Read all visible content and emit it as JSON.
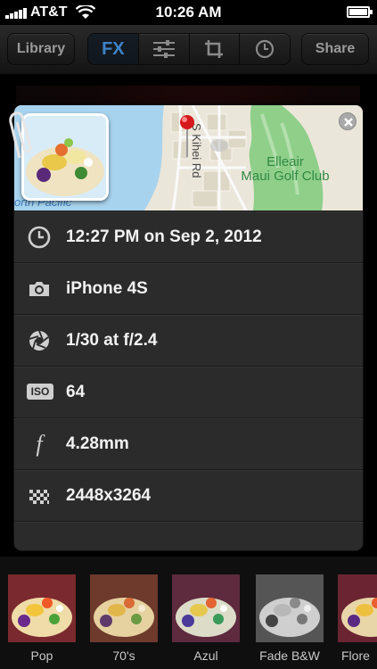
{
  "status_bar": {
    "carrier": "AT&T",
    "time": "10:26 AM"
  },
  "toolbar": {
    "library_label": "Library",
    "fx_label": "FX",
    "share_label": "Share",
    "segments": [
      "fx",
      "adjust-sliders-icon",
      "crop-icon",
      "history-clock-icon"
    ]
  },
  "info": {
    "map": {
      "street_label": "S Kihei Rd",
      "place_label_line1": "Elleair",
      "place_label_line2": "Maui Golf Club",
      "water_label": "orth Pacific"
    },
    "rows": [
      {
        "icon": "clock-icon",
        "value": "12:27 PM on Sep 2, 2012"
      },
      {
        "icon": "camera-icon",
        "value": "iPhone 4S"
      },
      {
        "icon": "aperture-icon",
        "value": "1/30 at f/2.4"
      },
      {
        "icon": "iso-icon",
        "icon_text": "ISO",
        "value": "64"
      },
      {
        "icon": "focal-length-icon",
        "icon_text": "f",
        "value": "4.28mm"
      },
      {
        "icon": "resolution-icon",
        "value": "2448x3264"
      }
    ]
  },
  "filters": [
    {
      "name": "Pop"
    },
    {
      "name": "70's"
    },
    {
      "name": "Azul"
    },
    {
      "name": "Fade B&W"
    },
    {
      "name": "Flore"
    }
  ],
  "colors": {
    "accent": "#3d83c9",
    "panel_bg": "#2b2b2b",
    "map_water": "#a8d3ee",
    "map_park": "#8fcf8a"
  }
}
